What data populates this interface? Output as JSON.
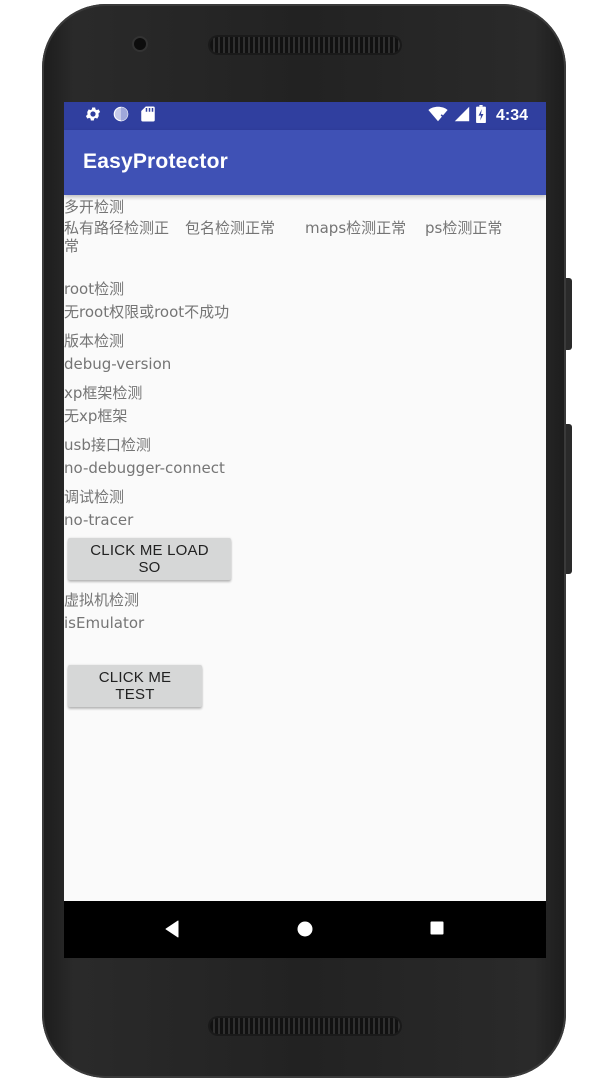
{
  "status_bar": {
    "time": "4:34",
    "left_icons": [
      "gear-icon",
      "sync-circle-icon",
      "sd-card-icon"
    ],
    "right_icons": [
      "wifi-icon",
      "cell-signal-icon",
      "battery-icon"
    ],
    "color": "#303f9f"
  },
  "app_bar": {
    "title": "EasyProtector",
    "color": "#3f51b5"
  },
  "sections": {
    "multi_open": {
      "heading": "多开检测",
      "private_path": "私有路径检测正常",
      "package_name": "包名检测正常",
      "maps": "maps检测正常",
      "ps": "ps检测正常"
    },
    "root": {
      "heading": "root检测",
      "result": "无root权限或root不成功"
    },
    "version": {
      "heading": "版本检测",
      "result": "debug-version"
    },
    "xposed": {
      "heading": "xp框架检测",
      "result": "无xp框架"
    },
    "usb": {
      "heading": "usb接口检测",
      "result": "no-debugger-connect"
    },
    "debug": {
      "heading": "调试检测",
      "result": "no-tracer"
    },
    "load_so_button": "CLICK ME LOAD SO",
    "emulator": {
      "heading": "虚拟机检测",
      "result": "isEmulator"
    },
    "test_button": "CLICK ME TEST"
  },
  "nav_bar": {
    "icons": [
      "back-icon",
      "home-icon",
      "recents-icon"
    ]
  }
}
